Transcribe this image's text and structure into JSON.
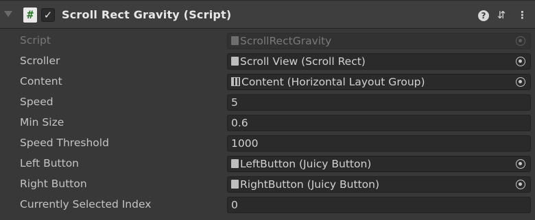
{
  "component": {
    "title": "Scroll Rect Gravity (Script)",
    "enabled_glyph": "✓",
    "script_icon_glyph": "#",
    "help_glyph": "?",
    "presets_glyph": "⇵",
    "menu_glyph": "⋮"
  },
  "fields": [
    {
      "label": "Script",
      "value": "ScrollRectGravity",
      "icon": "script-file-icon",
      "picker": true,
      "disabled": true
    },
    {
      "label": "Scroller",
      "value": "Scroll View (Scroll Rect)",
      "icon": "scroll-rect-icon",
      "picker": true
    },
    {
      "label": "Content",
      "value": "Content (Horizontal Layout Group)",
      "icon": "horizontal-layout-icon",
      "picker": true
    },
    {
      "label": "Speed",
      "value": "5"
    },
    {
      "label": "Min Size",
      "value": "0.6"
    },
    {
      "label": "Speed Threshold",
      "value": "1000"
    },
    {
      "label": "Left Button",
      "value": "LeftButton (Juicy Button)",
      "icon": "script-file-icon",
      "picker": true
    },
    {
      "label": "Right Button",
      "value": "RightButton (Juicy Button)",
      "icon": "script-file-icon",
      "picker": true
    },
    {
      "label": "Currently Selected Index",
      "value": "0"
    }
  ],
  "colors": {
    "background": "#383838",
    "header": "#3e3e3e",
    "field": "#2a2a2a",
    "text": "#c4c4c4"
  }
}
